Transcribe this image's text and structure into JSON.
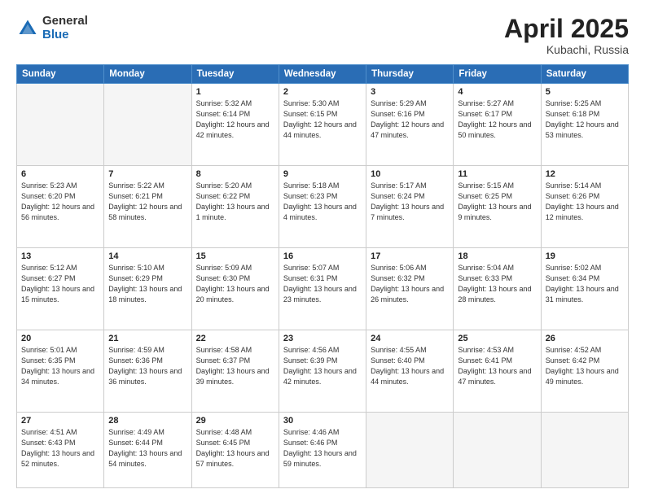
{
  "header": {
    "logo_general": "General",
    "logo_blue": "Blue",
    "title": "April 2025",
    "location": "Kubachi, Russia"
  },
  "days_of_week": [
    "Sunday",
    "Monday",
    "Tuesday",
    "Wednesday",
    "Thursday",
    "Friday",
    "Saturday"
  ],
  "weeks": [
    [
      {
        "day": "",
        "info": ""
      },
      {
        "day": "",
        "info": ""
      },
      {
        "day": "1",
        "sunrise": "Sunrise: 5:32 AM",
        "sunset": "Sunset: 6:14 PM",
        "daylight": "Daylight: 12 hours and 42 minutes."
      },
      {
        "day": "2",
        "sunrise": "Sunrise: 5:30 AM",
        "sunset": "Sunset: 6:15 PM",
        "daylight": "Daylight: 12 hours and 44 minutes."
      },
      {
        "day": "3",
        "sunrise": "Sunrise: 5:29 AM",
        "sunset": "Sunset: 6:16 PM",
        "daylight": "Daylight: 12 hours and 47 minutes."
      },
      {
        "day": "4",
        "sunrise": "Sunrise: 5:27 AM",
        "sunset": "Sunset: 6:17 PM",
        "daylight": "Daylight: 12 hours and 50 minutes."
      },
      {
        "day": "5",
        "sunrise": "Sunrise: 5:25 AM",
        "sunset": "Sunset: 6:18 PM",
        "daylight": "Daylight: 12 hours and 53 minutes."
      }
    ],
    [
      {
        "day": "6",
        "sunrise": "Sunrise: 5:23 AM",
        "sunset": "Sunset: 6:20 PM",
        "daylight": "Daylight: 12 hours and 56 minutes."
      },
      {
        "day": "7",
        "sunrise": "Sunrise: 5:22 AM",
        "sunset": "Sunset: 6:21 PM",
        "daylight": "Daylight: 12 hours and 58 minutes."
      },
      {
        "day": "8",
        "sunrise": "Sunrise: 5:20 AM",
        "sunset": "Sunset: 6:22 PM",
        "daylight": "Daylight: 13 hours and 1 minute."
      },
      {
        "day": "9",
        "sunrise": "Sunrise: 5:18 AM",
        "sunset": "Sunset: 6:23 PM",
        "daylight": "Daylight: 13 hours and 4 minutes."
      },
      {
        "day": "10",
        "sunrise": "Sunrise: 5:17 AM",
        "sunset": "Sunset: 6:24 PM",
        "daylight": "Daylight: 13 hours and 7 minutes."
      },
      {
        "day": "11",
        "sunrise": "Sunrise: 5:15 AM",
        "sunset": "Sunset: 6:25 PM",
        "daylight": "Daylight: 13 hours and 9 minutes."
      },
      {
        "day": "12",
        "sunrise": "Sunrise: 5:14 AM",
        "sunset": "Sunset: 6:26 PM",
        "daylight": "Daylight: 13 hours and 12 minutes."
      }
    ],
    [
      {
        "day": "13",
        "sunrise": "Sunrise: 5:12 AM",
        "sunset": "Sunset: 6:27 PM",
        "daylight": "Daylight: 13 hours and 15 minutes."
      },
      {
        "day": "14",
        "sunrise": "Sunrise: 5:10 AM",
        "sunset": "Sunset: 6:29 PM",
        "daylight": "Daylight: 13 hours and 18 minutes."
      },
      {
        "day": "15",
        "sunrise": "Sunrise: 5:09 AM",
        "sunset": "Sunset: 6:30 PM",
        "daylight": "Daylight: 13 hours and 20 minutes."
      },
      {
        "day": "16",
        "sunrise": "Sunrise: 5:07 AM",
        "sunset": "Sunset: 6:31 PM",
        "daylight": "Daylight: 13 hours and 23 minutes."
      },
      {
        "day": "17",
        "sunrise": "Sunrise: 5:06 AM",
        "sunset": "Sunset: 6:32 PM",
        "daylight": "Daylight: 13 hours and 26 minutes."
      },
      {
        "day": "18",
        "sunrise": "Sunrise: 5:04 AM",
        "sunset": "Sunset: 6:33 PM",
        "daylight": "Daylight: 13 hours and 28 minutes."
      },
      {
        "day": "19",
        "sunrise": "Sunrise: 5:02 AM",
        "sunset": "Sunset: 6:34 PM",
        "daylight": "Daylight: 13 hours and 31 minutes."
      }
    ],
    [
      {
        "day": "20",
        "sunrise": "Sunrise: 5:01 AM",
        "sunset": "Sunset: 6:35 PM",
        "daylight": "Daylight: 13 hours and 34 minutes."
      },
      {
        "day": "21",
        "sunrise": "Sunrise: 4:59 AM",
        "sunset": "Sunset: 6:36 PM",
        "daylight": "Daylight: 13 hours and 36 minutes."
      },
      {
        "day": "22",
        "sunrise": "Sunrise: 4:58 AM",
        "sunset": "Sunset: 6:37 PM",
        "daylight": "Daylight: 13 hours and 39 minutes."
      },
      {
        "day": "23",
        "sunrise": "Sunrise: 4:56 AM",
        "sunset": "Sunset: 6:39 PM",
        "daylight": "Daylight: 13 hours and 42 minutes."
      },
      {
        "day": "24",
        "sunrise": "Sunrise: 4:55 AM",
        "sunset": "Sunset: 6:40 PM",
        "daylight": "Daylight: 13 hours and 44 minutes."
      },
      {
        "day": "25",
        "sunrise": "Sunrise: 4:53 AM",
        "sunset": "Sunset: 6:41 PM",
        "daylight": "Daylight: 13 hours and 47 minutes."
      },
      {
        "day": "26",
        "sunrise": "Sunrise: 4:52 AM",
        "sunset": "Sunset: 6:42 PM",
        "daylight": "Daylight: 13 hours and 49 minutes."
      }
    ],
    [
      {
        "day": "27",
        "sunrise": "Sunrise: 4:51 AM",
        "sunset": "Sunset: 6:43 PM",
        "daylight": "Daylight: 13 hours and 52 minutes."
      },
      {
        "day": "28",
        "sunrise": "Sunrise: 4:49 AM",
        "sunset": "Sunset: 6:44 PM",
        "daylight": "Daylight: 13 hours and 54 minutes."
      },
      {
        "day": "29",
        "sunrise": "Sunrise: 4:48 AM",
        "sunset": "Sunset: 6:45 PM",
        "daylight": "Daylight: 13 hours and 57 minutes."
      },
      {
        "day": "30",
        "sunrise": "Sunrise: 4:46 AM",
        "sunset": "Sunset: 6:46 PM",
        "daylight": "Daylight: 13 hours and 59 minutes."
      },
      {
        "day": "",
        "info": ""
      },
      {
        "day": "",
        "info": ""
      },
      {
        "day": "",
        "info": ""
      }
    ]
  ]
}
